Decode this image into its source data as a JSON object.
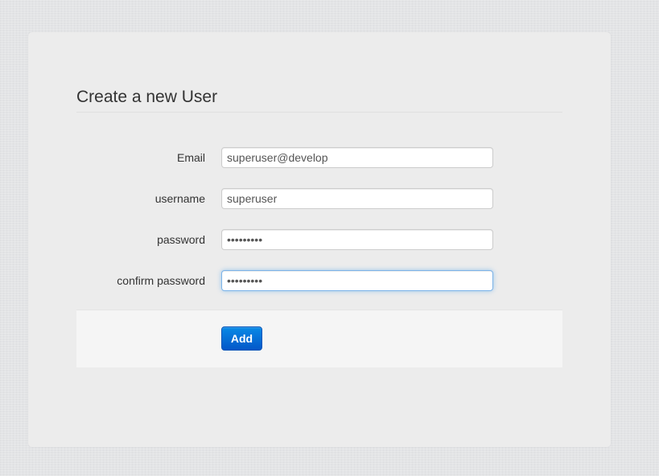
{
  "form": {
    "title": "Create a new User",
    "fields": {
      "email": {
        "label": "Email",
        "value": "superuser@develop"
      },
      "username": {
        "label": "username",
        "value": "superuser"
      },
      "password": {
        "label": "password",
        "value": "•••••••••"
      },
      "confirm_password": {
        "label": "confirm password",
        "value": "•••••••••"
      }
    },
    "submit_label": "Add",
    "accent_color": "#0357c8",
    "focused_field": "confirm_password"
  }
}
